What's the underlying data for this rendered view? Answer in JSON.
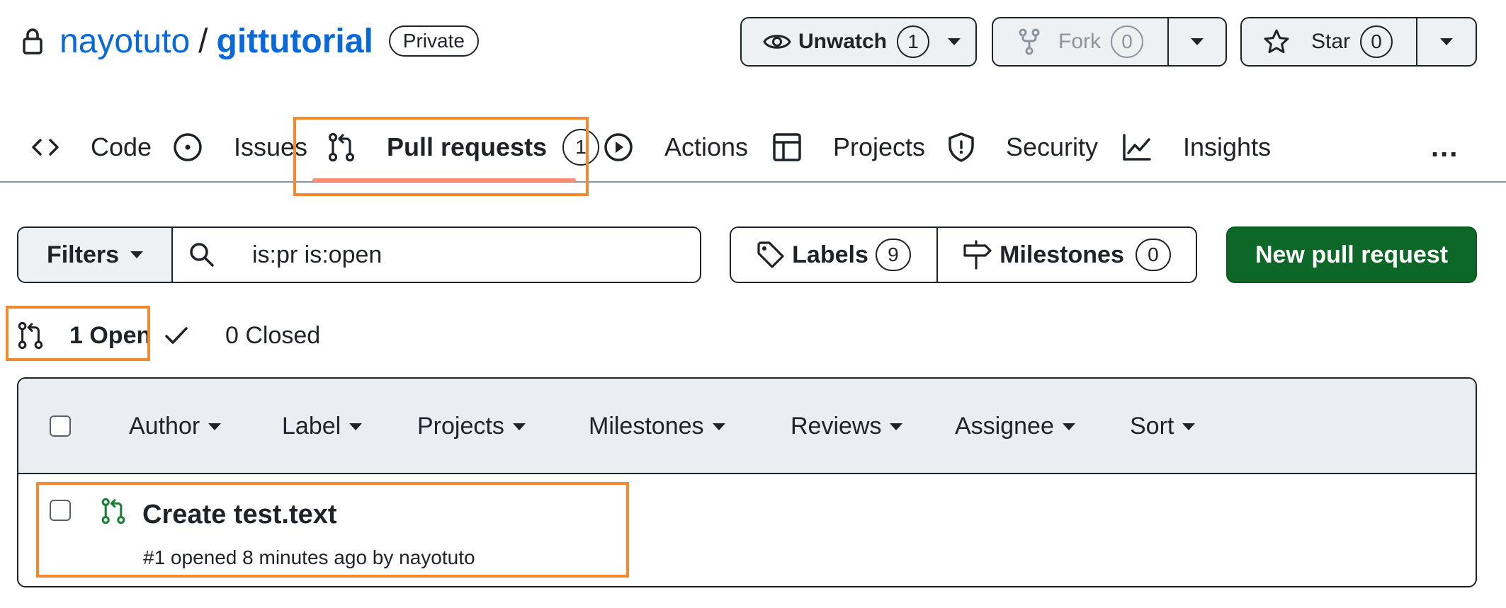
{
  "repo": {
    "owner": "nayotuto",
    "separator": "/",
    "name": "gittutorial",
    "visibility": "Private"
  },
  "header_actions": {
    "watch": {
      "label": "Unwatch",
      "count": "1"
    },
    "fork": {
      "label": "Fork",
      "count": "0"
    },
    "star": {
      "label": "Star",
      "count": "0"
    }
  },
  "tabs": [
    {
      "label": "Code",
      "icon": "code-icon"
    },
    {
      "label": "Issues",
      "icon": "issue-opened-icon"
    },
    {
      "label": "Pull requests",
      "icon": "git-pull-request-icon",
      "count": "1",
      "active": true
    },
    {
      "label": "Actions",
      "icon": "play-icon"
    },
    {
      "label": "Projects",
      "icon": "table-icon"
    },
    {
      "label": "Security",
      "icon": "shield-icon"
    },
    {
      "label": "Insights",
      "icon": "graph-icon"
    }
  ],
  "more_menu": "...",
  "filter_bar": {
    "filters_label": "Filters",
    "search_value": "is:pr is:open",
    "labels": {
      "label": "Labels",
      "count": "9"
    },
    "milestones": {
      "label": "Milestones",
      "count": "0"
    },
    "new_pr_label": "New pull request"
  },
  "states": {
    "open": "1 Open",
    "closed": "0 Closed"
  },
  "list_header": {
    "columns": [
      "Author",
      "Label",
      "Projects",
      "Milestones",
      "Reviews",
      "Assignee",
      "Sort"
    ]
  },
  "pull_requests": [
    {
      "title": "Create test.text",
      "meta": "#1 opened 8 minutes ago by nayotuto"
    }
  ],
  "colors": {
    "link": "#0969da",
    "primary_button": "#0d6727",
    "open_pr_icon": "#1a7f37",
    "highlight": "#f4892f",
    "tab_underline": "#fd8c73"
  }
}
